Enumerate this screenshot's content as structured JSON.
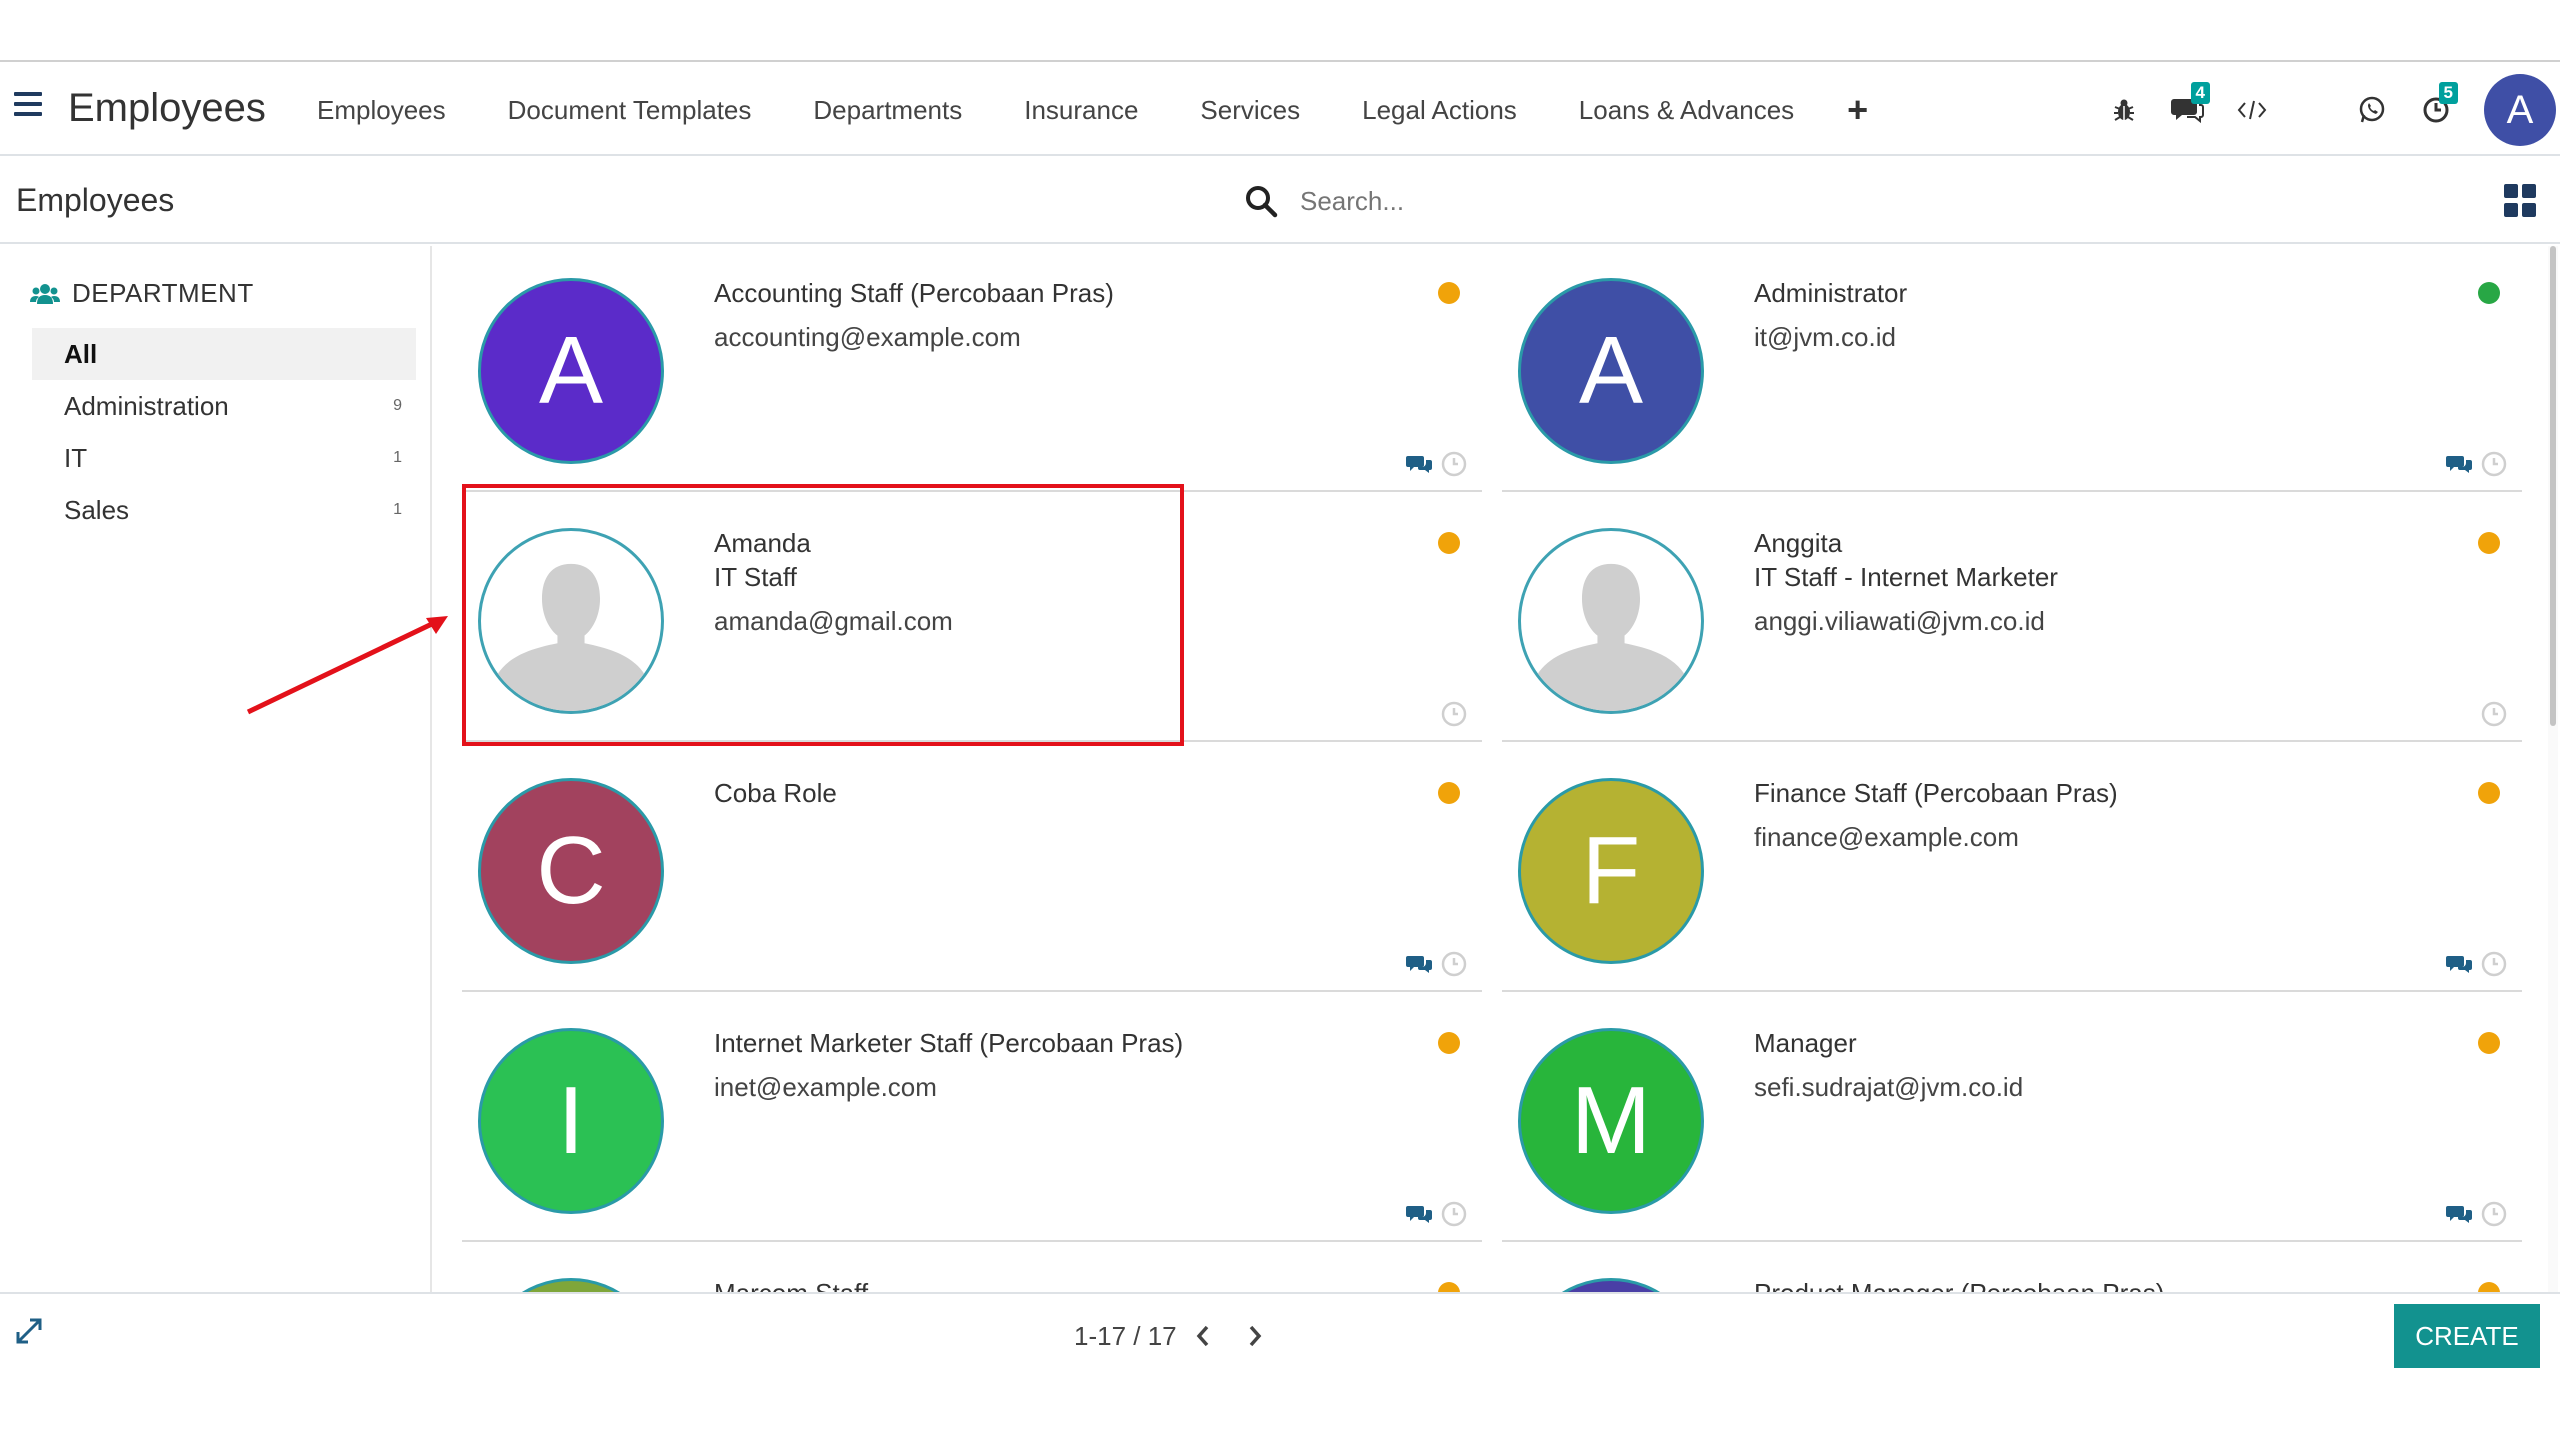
{
  "navbar": {
    "app_name": "Employees",
    "menu": [
      "Employees",
      "Document Templates",
      "Departments",
      "Insurance",
      "Services",
      "Legal Actions",
      "Loans & Advances"
    ],
    "plus_label": "+",
    "messages_badge": "4",
    "activities_badge": "5",
    "avatar_letter": "A",
    "icons": [
      "bug-icon",
      "chat-icon",
      "code-icon",
      "whatsapp-icon",
      "activity-clock-icon"
    ]
  },
  "control_panel": {
    "breadcrumb": "Employees",
    "search_placeholder": "Search..."
  },
  "sidebar": {
    "header": "DEPARTMENT",
    "items": [
      {
        "label": "All",
        "count": ""
      },
      {
        "label": "Administration",
        "count": "9"
      },
      {
        "label": "IT",
        "count": "1"
      },
      {
        "label": "Sales",
        "count": "1"
      }
    ]
  },
  "employees": [
    {
      "name": "Accounting Staff (Percobaan Pras)",
      "job": "",
      "email": "accounting@example.com",
      "initial": "A",
      "avatar_color": "#5b2bc9",
      "status_color": "#f0a30a"
    },
    {
      "name": "Administrator",
      "job": "",
      "email": "it@jvm.co.id",
      "initial": "A",
      "avatar_color": "#3f4fa6",
      "status_color": "#28a745"
    },
    {
      "name": "Amanda",
      "job": "IT Staff",
      "email": "amanda@gmail.com",
      "initial": "",
      "avatar_color": "#ffffff",
      "status_color": "#f0a30a"
    },
    {
      "name": "Anggita",
      "job": "IT Staff - Internet Marketer",
      "email": "anggi.viliawati@jvm.co.id",
      "initial": "",
      "avatar_color": "#ffffff",
      "status_color": "#f0a30a"
    },
    {
      "name": "Coba Role",
      "job": "",
      "email": "",
      "initial": "C",
      "avatar_color": "#a2425e",
      "status_color": "#f0a30a"
    },
    {
      "name": "Finance Staff (Percobaan Pras)",
      "job": "",
      "email": "finance@example.com",
      "initial": "F",
      "avatar_color": "#b5b232",
      "status_color": "#f0a30a"
    },
    {
      "name": "Internet Marketer Staff (Percobaan Pras)",
      "job": "",
      "email": "inet@example.com",
      "initial": "I",
      "avatar_color": "#2bc154",
      "status_color": "#f0a30a"
    },
    {
      "name": "Manager",
      "job": "",
      "email": "sefi.sudrajat@jvm.co.id",
      "initial": "M",
      "avatar_color": "#28b53b",
      "status_color": "#f0a30a"
    },
    {
      "name": "Marcom Staff",
      "job": "",
      "email": "",
      "initial": "",
      "avatar_color": "#7fa63a",
      "status_color": "#f0a30a"
    },
    {
      "name": "Product Manager (Percobaan Pras)",
      "job": "",
      "email": "",
      "initial": "",
      "avatar_color": "#4a3fa6",
      "status_color": "#f0a30a"
    }
  ],
  "pager": {
    "value": "1-17 / 17"
  },
  "create_label": "CREATE",
  "colors": {
    "accent": "#12928f",
    "highlight": "#e3111a"
  }
}
